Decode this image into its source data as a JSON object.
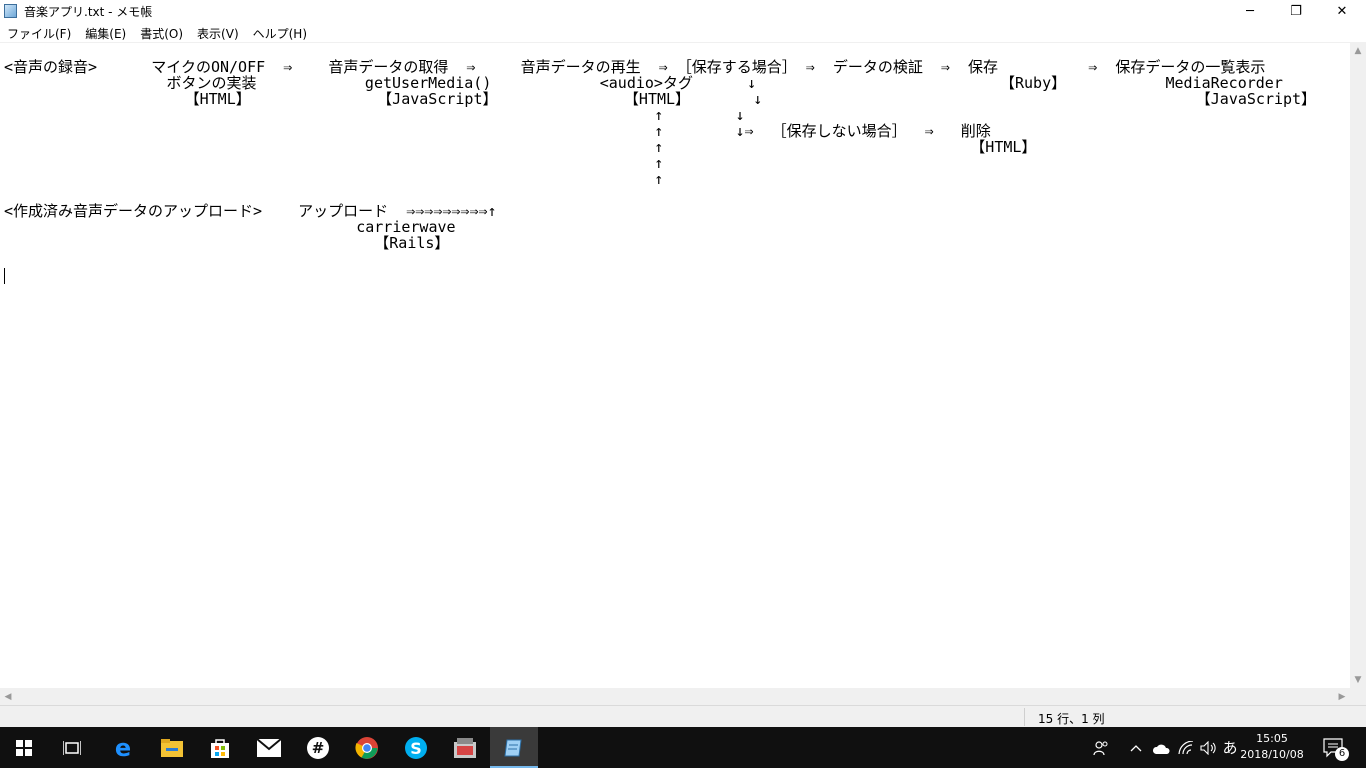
{
  "window": {
    "title": "音楽アプリ.txt - メモ帳",
    "min_glyph": "─",
    "max_glyph": "❐",
    "close_glyph": "✕"
  },
  "menu": [
    "ファイル(F)",
    "編集(E)",
    "書式(O)",
    "表示(V)",
    "ヘルプ(H)"
  ],
  "document": {
    "lines": [
      "<音声の録音>      マイクのON/OFF  ⇒    音声データの取得  ⇒     音声データの再生  ⇒ ［保存する場合］ ⇒  データの検証  ⇒  保存          ⇒  保存データの一覧表示",
      "                  ボタンの実装            getUserMedia()            <audio>タグ      ↓                           【Ruby】           MediaRecorder             【Rails】",
      "                    【HTML】              【JavaScript】              【HTML】       ↓                                                【JavaScript】",
      "                                                                        ↑        ↓",
      "                                                                        ↑        ↓⇒  ［保存しない場合］  ⇒   削除",
      "                                                                        ↑                                  【HTML】",
      "                                                                        ↑",
      "                                                                        ↑",
      "<作成済み音声データのアップロード>    アップロード  ⇒⇒⇒⇒⇒⇒⇒⇒⇒↑",
      "                                       carrierwave",
      "                                         【Rails】"
    ]
  },
  "status": {
    "position": "15 行、1 列"
  },
  "taskbar": {
    "icons": [
      "windows-start-icon",
      "task-view-icon",
      "edge-icon",
      "file-explorer-icon",
      "store-icon",
      "mail-icon",
      "slack-icon",
      "chrome-icon",
      "skype-icon",
      "photos-icon",
      "notepad-icon"
    ],
    "tray": {
      "ime_label": "あ",
      "time": "15:05",
      "date": "2018/10/08",
      "notification_count": "6"
    }
  }
}
